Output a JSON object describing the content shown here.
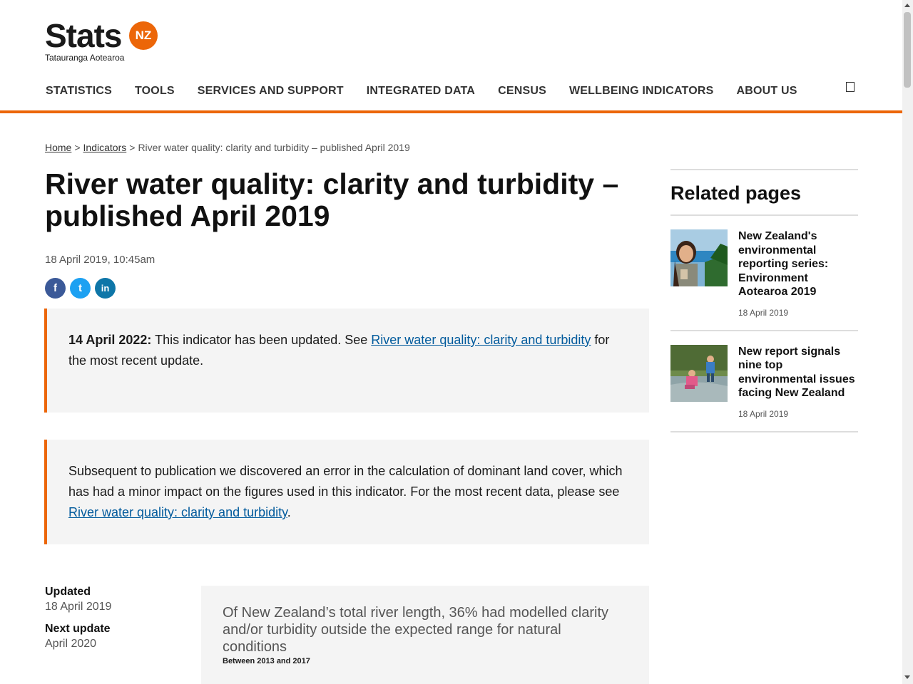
{
  "header": {
    "logo_word": "Stats",
    "logo_badge": "NZ",
    "logo_subtitle": "Tatauranga Aotearoa"
  },
  "nav": {
    "items": [
      {
        "label": "STATISTICS"
      },
      {
        "label": "TOOLS"
      },
      {
        "label": "SERVICES AND SUPPORT"
      },
      {
        "label": "INTEGRATED DATA"
      },
      {
        "label": "CENSUS"
      },
      {
        "label": "WELLBEING INDICATORS"
      },
      {
        "label": "ABOUT US"
      }
    ]
  },
  "breadcrumb": {
    "home": "Home",
    "sep": ">",
    "indicators": "Indicators",
    "current": "River water quality: clarity and turbidity – published April 2019"
  },
  "page": {
    "title": "River water quality: clarity and turbidity – published April 2019",
    "timestamp": "18 April 2019, 10:45am"
  },
  "social": {
    "facebook": "f",
    "twitter": "t",
    "linkedin": "in"
  },
  "notice1": {
    "date_bold": "14 April 2022:",
    "text_before": " This indicator has been updated. See ",
    "link": "River water quality: clarity and turbidity",
    "text_after": " for the most recent update."
  },
  "notice2": {
    "text_before": "Subsequent to publication we discovered an error in the calculation of dominant land cover, which has had a minor impact on the figures used in this indicator. For the most recent data, please see ",
    "link": "River water quality: clarity and turbidity",
    "text_after": "."
  },
  "meta": {
    "updated_label": "Updated",
    "updated_value": "18 April 2019",
    "next_label": "Next update",
    "next_value": "April 2020"
  },
  "summary": {
    "text": "Of New Zealand’s total river length, 36% had modelled clarity and/or turbidity outside the expected range for natural conditions",
    "sub": "Between 2013 and 2017"
  },
  "sidebar": {
    "title": "Related pages",
    "items": [
      {
        "title": "New Zealand's environmental reporting series: Environment Aotearoa 2019",
        "date": "18 April 2019"
      },
      {
        "title": "New report signals nine top environmental issues facing New Zealand",
        "date": "18 April 2019"
      }
    ]
  }
}
